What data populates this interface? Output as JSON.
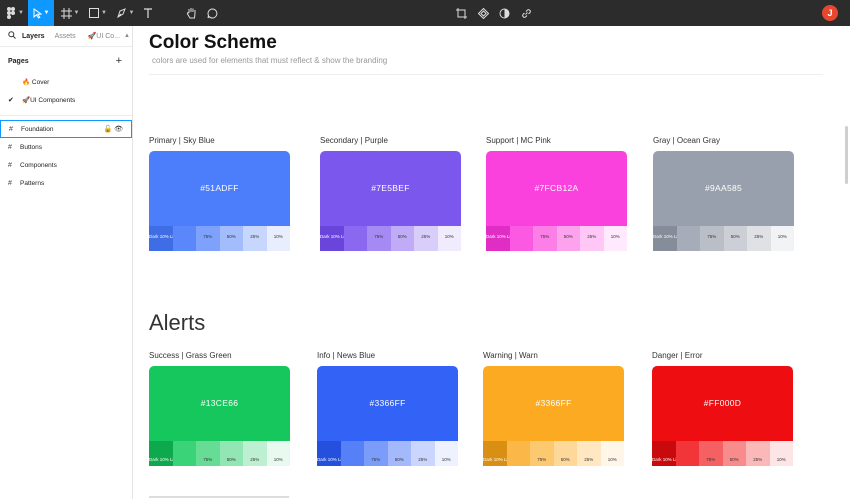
{
  "toolbar": {
    "avatar_initial": "J",
    "accent": "#0d99ff"
  },
  "panel": {
    "tabs": [
      "Layers",
      "Assets"
    ],
    "file_name": "🚀UI Co...",
    "pages_label": "Pages",
    "pages": [
      {
        "label": "🔥 Cover",
        "checked": false
      },
      {
        "label": "🚀UI Components",
        "checked": true
      }
    ],
    "layers": [
      {
        "label": "Foundation",
        "selected": true
      },
      {
        "label": "Buttons",
        "selected": false
      },
      {
        "label": "Components",
        "selected": false
      },
      {
        "label": "Patterns",
        "selected": false
      }
    ]
  },
  "canvas": {
    "title": "Color Scheme",
    "subtitle": "colors are used for elements that must reflect & show the branding",
    "alerts_title": "Alerts",
    "brand_cards": [
      {
        "label": "Primary | Sky Blue",
        "hex": "#51ADFF",
        "color": "#4c7dfa",
        "shades": [
          "#3f6de6",
          "#5a88fb",
          "#7ea1fb",
          "#a3bcfc",
          "#c7d6fd",
          "#e9eefe"
        ]
      },
      {
        "label": "Secondary | Purple",
        "hex": "#7E5BEF",
        "color": "#7b57ee",
        "shades": [
          "#6a45dc",
          "#8a68f0",
          "#a58af3",
          "#bfabf6",
          "#d9cdfa",
          "#f1ecfd"
        ]
      },
      {
        "label": "Support | MC Pink",
        "hex": "#7FCB12A",
        "color": "#fb41dd",
        "shades": [
          "#e02ec4",
          "#fb59e1",
          "#fc7ee7",
          "#fda3ee",
          "#fec7f5",
          "#ffe9fc"
        ]
      },
      {
        "label": "Gray | Ocean Gray",
        "hex": "#9AA585",
        "color": "#98a0ad",
        "shades": [
          "#858d9a",
          "#a6adb8",
          "#b9bec7",
          "#ccd0d6",
          "#dfe1e5",
          "#f2f3f5"
        ]
      }
    ],
    "alert_cards": [
      {
        "label": "Success | Grass Green",
        "hex": "#13CE66",
        "color": "#16c75d",
        "shades": [
          "#0fa94d",
          "#3ad377",
          "#66dc95",
          "#91e6b3",
          "#bdf0d1",
          "#e8faef"
        ]
      },
      {
        "label": "Info | News Blue",
        "hex": "#3366FF",
        "color": "#3262f6",
        "shades": [
          "#2450dd",
          "#5580f8",
          "#7c9cf9",
          "#a3b9fb",
          "#cad6fd",
          "#eef2fe"
        ]
      },
      {
        "label": "Warning | Warn",
        "hex": "#3366FF",
        "color": "#fbaa22",
        "shades": [
          "#d98f14",
          "#fbb848",
          "#fcc870",
          "#fdd898",
          "#fee7c1",
          "#fff6e8"
        ]
      },
      {
        "label": "Danger | Error",
        "hex": "#FF000D",
        "color": "#ee0d10",
        "shades": [
          "#c90a0d",
          "#f23538",
          "#f56062",
          "#f88c8d",
          "#fbb8b9",
          "#fee5e5"
        ]
      }
    ],
    "shade_labels": [
      "Dark 10%  Light 90%",
      "",
      "75%",
      "50%",
      "25%",
      "10%"
    ]
  }
}
